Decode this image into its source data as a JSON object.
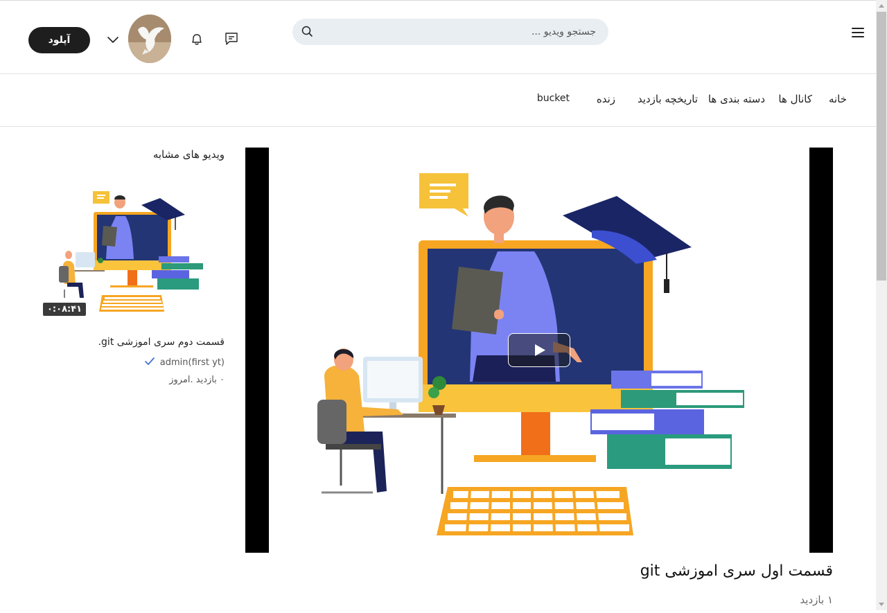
{
  "header": {
    "search_placeholder": "جستجو ویدیو ...",
    "upload_label": "آپلود"
  },
  "nav": {
    "items": [
      {
        "label": "خانه"
      },
      {
        "label": "کانال ها"
      },
      {
        "label": "دسته بندی ها"
      },
      {
        "label": "تاریخچه بازدید"
      },
      {
        "label": "زنده"
      },
      {
        "label": "bucket"
      }
    ]
  },
  "video": {
    "title": "قسمت اول سری اموزشی git",
    "views": "۱ بازدید"
  },
  "related": {
    "heading": "ویدیو های مشابه",
    "items": [
      {
        "title": "قسمت دوم سری اموزشی git.",
        "channel": "admin(first yt)",
        "meta": "۰ بازدید .امروز",
        "duration": "۰:۰۸:۴۱"
      }
    ]
  },
  "colors": {
    "upload_bg": "#1e1e1e",
    "search_bg": "#e8eef2",
    "accent_blue": "#3e6fd8"
  },
  "icons": {
    "menu": "hamburger-icon",
    "search": "search-icon",
    "messages": "message-icon",
    "notifications": "bell-icon",
    "dropdown": "chevron-down-icon",
    "play": "play-icon",
    "verified": "check-icon"
  }
}
